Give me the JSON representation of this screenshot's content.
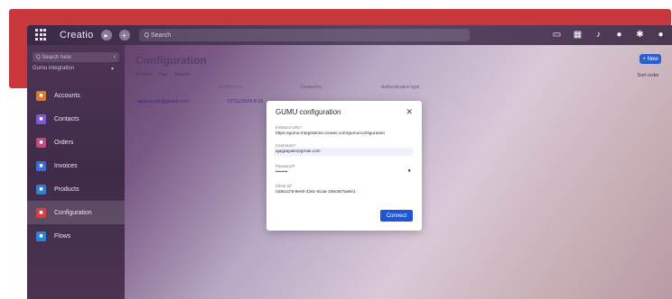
{
  "app": {
    "logo_text": "Creatio"
  },
  "topbar": {
    "search_placeholder": "Q  Search",
    "icons": [
      "video-icon",
      "grid-icon",
      "bell-icon",
      "help-icon",
      "settings-icon",
      "user-icon"
    ]
  },
  "sidebar": {
    "search_placeholder": "Q  Search here",
    "org_label": "Gumu integration",
    "items": [
      {
        "label": "Accounts",
        "icon": "accounts-icon",
        "color": "#d77a2e"
      },
      {
        "label": "Contacts",
        "icon": "contacts-icon",
        "color": "#7b5ad6"
      },
      {
        "label": "Orders",
        "icon": "orders-icon",
        "color": "#c24a7a"
      },
      {
        "label": "Invoices",
        "icon": "invoices-icon",
        "color": "#3a6ad6"
      },
      {
        "label": "Products",
        "icon": "products-icon",
        "color": "#2f7ed0"
      },
      {
        "label": "Configuration",
        "icon": "configuration-icon",
        "color": "#d84040",
        "active": true
      },
      {
        "label": "Flows",
        "icon": "flows-icon",
        "color": "#2a84d8"
      }
    ]
  },
  "main": {
    "title": "Configuration",
    "new_button": "+ New",
    "filters": [
      "Actions",
      "Tag",
      "Search"
    ],
    "sort_label": "Sort order",
    "columns": [
      "Username",
      "Modified on",
      "Created by",
      "Authentication type"
    ],
    "rows": [
      {
        "username": "ajaypayale@gmail.com",
        "modified": "07/11/2024 8:15"
      }
    ]
  },
  "modal": {
    "title": "GUMU configuration",
    "fields": [
      {
        "label": "Instance URL*",
        "value": "https://gumu-integrations.creatio.com/gumu/configuration"
      },
      {
        "label": "Username*",
        "value": "ajaypayale@gmail.com"
      },
      {
        "label": "Password*",
        "value": "••••••••"
      },
      {
        "label": "Client Id*",
        "value": "f4d61a78-9ee0-426c-8cda-1f9e3675a8e1"
      }
    ],
    "connect_label": "Connect"
  }
}
